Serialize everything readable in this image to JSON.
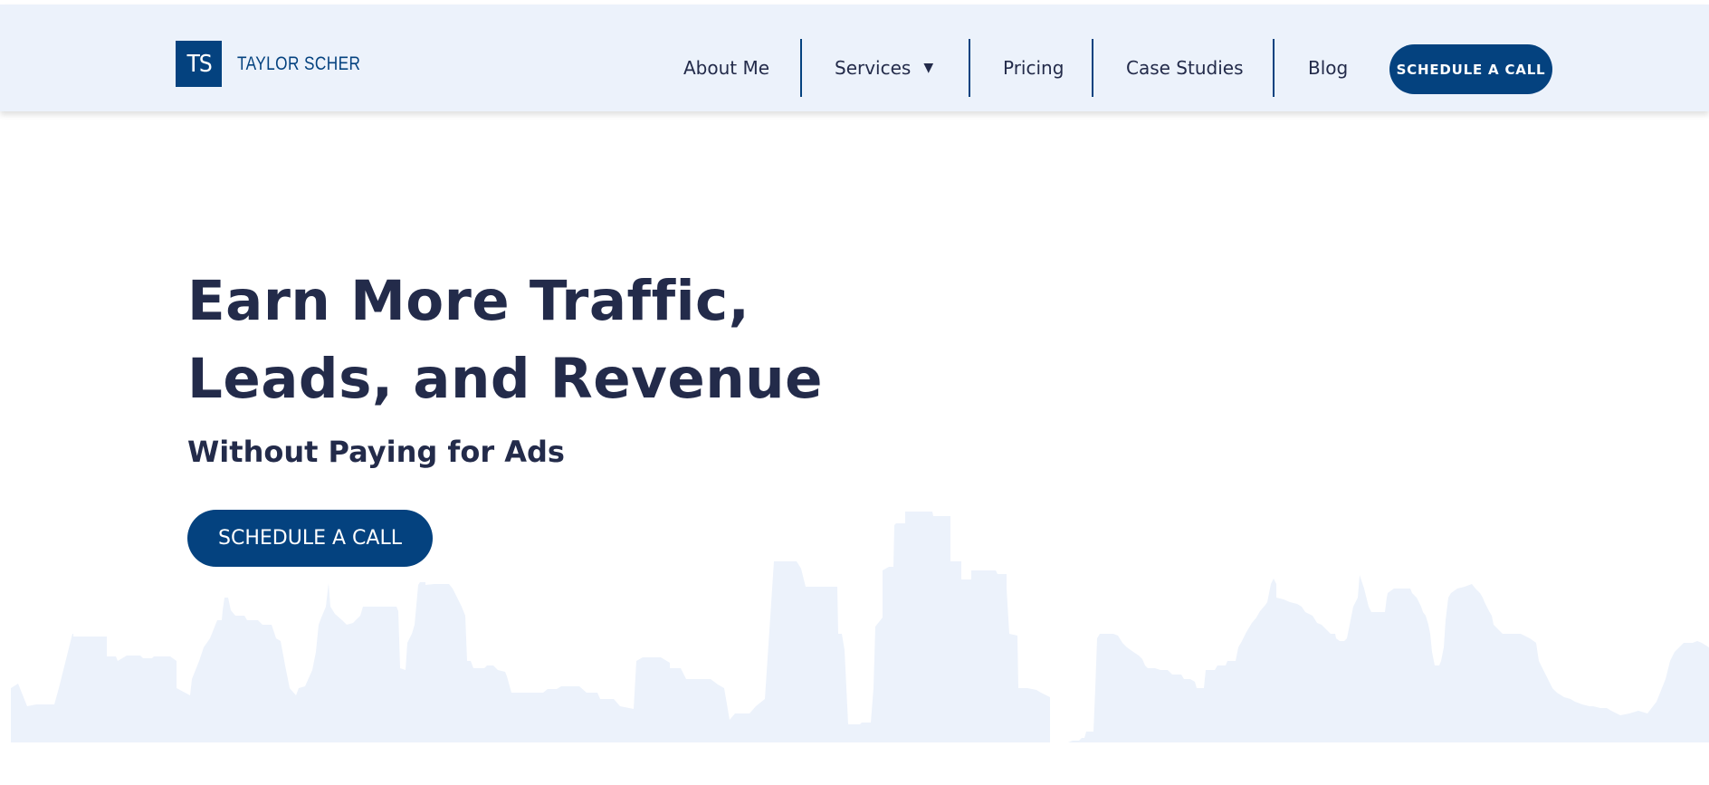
{
  "brand": {
    "logo_mark": "TS",
    "name": "TAYLOR SCHER"
  },
  "nav": {
    "items": [
      {
        "label": "About Me"
      },
      {
        "label": "Services",
        "has_dropdown": true
      },
      {
        "label": "Pricing"
      },
      {
        "label": "Case Studies"
      },
      {
        "label": "Blog"
      }
    ],
    "cta_label": "SCHEDULE A CALL"
  },
  "hero": {
    "title_line_1": "Earn More Traffic,",
    "title_line_2": "Leads, and Revenue",
    "subtitle": "Without Paying for Ads",
    "cta_label": "SCHEDULE A CALL"
  },
  "colors": {
    "brand_blue": "#04427f",
    "heading_navy": "#232b4a",
    "header_bg": "#ecf2fb",
    "skyline": "#ecf2fb"
  },
  "icons": {
    "services_dropdown": "caret-down-icon",
    "background": "city-skyline"
  }
}
